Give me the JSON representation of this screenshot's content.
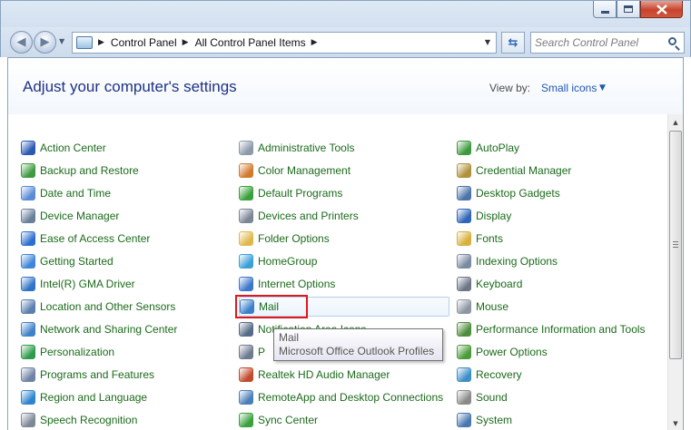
{
  "window": {
    "minimize": "minimize",
    "maximize": "maximize",
    "close": "close"
  },
  "address_bar": {
    "crumbs": [
      "Control Panel",
      "All Control Panel Items"
    ]
  },
  "search": {
    "placeholder": "Search Control Panel"
  },
  "header": {
    "title": "Adjust your computer's settings",
    "view_by_label": "View by:",
    "view_by_value": "Small icons"
  },
  "items": {
    "col1": [
      {
        "label": "Action Center",
        "icon": "flag-icon",
        "color": "#2a58b3"
      },
      {
        "label": "Backup and Restore",
        "icon": "backup-icon",
        "color": "#3f9a3f"
      },
      {
        "label": "Date and Time",
        "icon": "clock-icon",
        "color": "#5b8ad6"
      },
      {
        "label": "Device Manager",
        "icon": "device-manager-icon",
        "color": "#6a7f99"
      },
      {
        "label": "Ease of Access Center",
        "icon": "ease-of-access-icon",
        "color": "#2d6fd1"
      },
      {
        "label": "Getting Started",
        "icon": "getting-started-icon",
        "color": "#3e86d9"
      },
      {
        "label": "Intel(R) GMA Driver",
        "icon": "intel-icon",
        "color": "#2f73c8"
      },
      {
        "label": "Location and Other Sensors",
        "icon": "sensors-icon",
        "color": "#5a7fb0"
      },
      {
        "label": "Network and Sharing Center",
        "icon": "network-icon",
        "color": "#3e82c9"
      },
      {
        "label": "Personalization",
        "icon": "personalization-icon",
        "color": "#2e9b4d"
      },
      {
        "label": "Programs and Features",
        "icon": "programs-icon",
        "color": "#6f83a6"
      },
      {
        "label": "Region and Language",
        "icon": "globe-icon",
        "color": "#2f84cf"
      },
      {
        "label": "Speech Recognition",
        "icon": "microphone-icon",
        "color": "#7d8796"
      }
    ],
    "col2": [
      {
        "label": "Administrative Tools",
        "icon": "admin-tools-icon",
        "color": "#8c9aab"
      },
      {
        "label": "Color Management",
        "icon": "color-management-icon",
        "color": "#d27a2c"
      },
      {
        "label": "Default Programs",
        "icon": "default-programs-icon",
        "color": "#3aa03a"
      },
      {
        "label": "Devices and Printers",
        "icon": "printer-icon",
        "color": "#7b8796"
      },
      {
        "label": "Folder Options",
        "icon": "folder-icon",
        "color": "#e0b94c"
      },
      {
        "label": "HomeGroup",
        "icon": "homegroup-icon",
        "color": "#3ca0d8"
      },
      {
        "label": "Internet Options",
        "icon": "internet-options-icon",
        "color": "#3d78c9"
      },
      {
        "label": "Mail",
        "icon": "mail-icon",
        "color": "#3c7fc9"
      },
      {
        "label": "Notification Area Icons",
        "icon": "notification-icon",
        "color": "#566b86"
      },
      {
        "label": "P",
        "icon": "phone-modem-icon",
        "color": "#6d7b8f"
      },
      {
        "label": "Realtek HD Audio Manager",
        "icon": "audio-manager-icon",
        "color": "#c24a2d"
      },
      {
        "label": "RemoteApp and Desktop Connections",
        "icon": "remoteapp-icon",
        "color": "#4a7fb8"
      },
      {
        "label": "Sync Center",
        "icon": "sync-icon",
        "color": "#39a13d"
      }
    ],
    "col3": [
      {
        "label": "AutoPlay",
        "icon": "autoplay-icon",
        "color": "#3e9a3e"
      },
      {
        "label": "Credential Manager",
        "icon": "credential-icon",
        "color": "#b0903a"
      },
      {
        "label": "Desktop Gadgets",
        "icon": "gadgets-icon",
        "color": "#4c74a8"
      },
      {
        "label": "Display",
        "icon": "display-icon",
        "color": "#2f66b8"
      },
      {
        "label": "Fonts",
        "icon": "fonts-icon",
        "color": "#d8b03c"
      },
      {
        "label": "Indexing Options",
        "icon": "indexing-icon",
        "color": "#7a8ba0"
      },
      {
        "label": "Keyboard",
        "icon": "keyboard-icon",
        "color": "#6c7686"
      },
      {
        "label": "Mouse",
        "icon": "mouse-icon",
        "color": "#8d96a3"
      },
      {
        "label": "Performance Information and Tools",
        "icon": "performance-icon",
        "color": "#4e8d3e"
      },
      {
        "label": "Power Options",
        "icon": "power-icon",
        "color": "#4b9b3a"
      },
      {
        "label": "Recovery",
        "icon": "recovery-icon",
        "color": "#3c8fc8"
      },
      {
        "label": "Sound",
        "icon": "speaker-icon",
        "color": "#8a8a8a"
      },
      {
        "label": "System",
        "icon": "system-icon",
        "color": "#4a77b0"
      }
    ]
  },
  "tooltip": {
    "line1": "Mail",
    "line2": "Microsoft Office Outlook Profiles"
  },
  "colors": {
    "link": "#1b6a1b",
    "title": "#1e3287",
    "accent": "#1d57b5",
    "highlight": "#e01818"
  }
}
